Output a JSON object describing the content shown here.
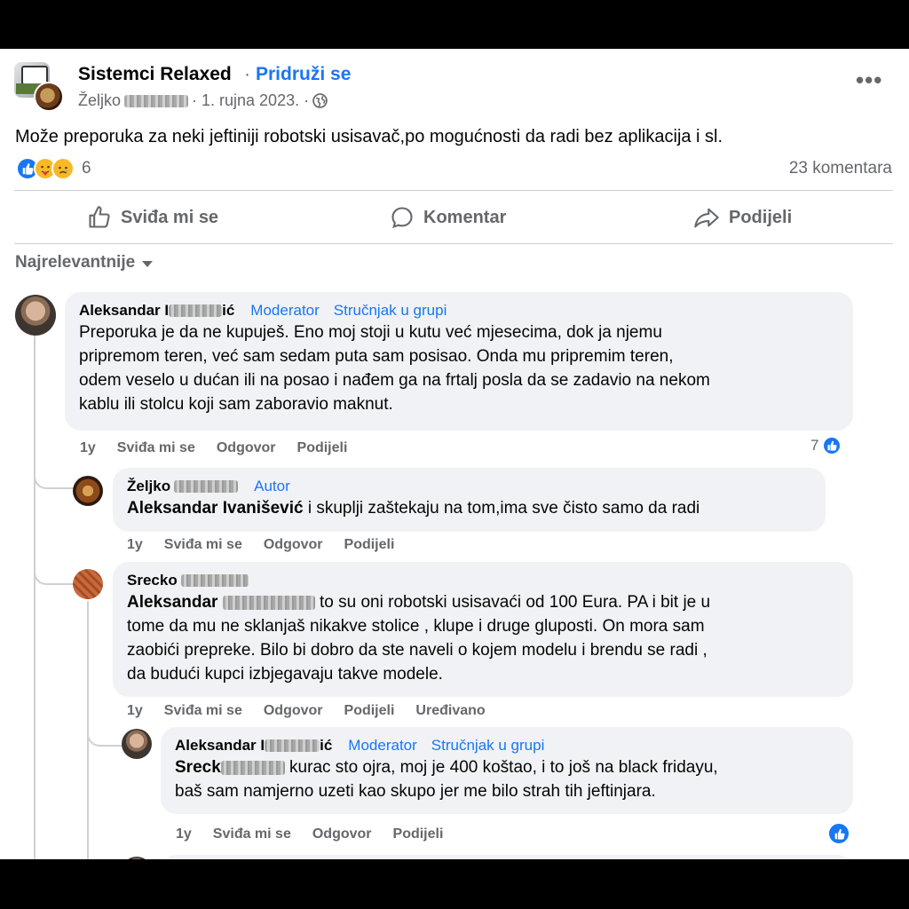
{
  "header": {
    "group_name": "Sistemci Relaxed",
    "separator": "·",
    "join_label": "Pridruži se",
    "author_first": "Željko",
    "date": "· 1. rujna 2023. ·"
  },
  "post": {
    "text": "Može preporuka za neki jeftiniji robotski usisavač,po mogućnosti da radi bez aplikacija i sl.",
    "reaction_count": "6",
    "comment_count": "23 komentara"
  },
  "actions": {
    "like": "Sviđa mi se",
    "comment": "Komentar",
    "share": "Podijeli"
  },
  "sort_label": "Najrelevantnije",
  "comments": [
    {
      "name_prefix": "Aleksandar I",
      "name_suffix": "ić",
      "badge1": "Moderator",
      "badge2": "Stručnjak u grupi",
      "lines": [
        "Preporuka je da ne kupuješ. Eno moj stoji u kutu već mjesecima, dok ja njemu",
        "pripremom teren, već sam sedam puta sam posisao. Onda mu pripremim teren,",
        "odem veselo u dućan ili na posao i nađem ga na frtalj posla da se zadavio na nekom",
        "kablu ili stolcu koji sam zaboravio maknut."
      ],
      "time": "1y",
      "like": "Sviđa mi se",
      "reply": "Odgovor",
      "share": "Podijeli",
      "likes": "7"
    },
    {
      "name_prefix": "Željko",
      "badge1": "Autor",
      "mention": "Aleksandar Ivanišević",
      "text": " i skuplji zaštekaju na tom,ima sve čisto samo da radi",
      "time": "1y",
      "like": "Sviđa mi se",
      "reply": "Odgovor",
      "share": "Podijeli"
    },
    {
      "name_prefix": "Srecko",
      "mention": "Aleksandar",
      "line1_rest": "to su oni robotski usisavaći od 100 Eura. PA i bit je u",
      "lines": [
        "tome da mu ne sklanjaš nikakve stolice , klupe i druge gluposti. On mora sam",
        "zaobići prepreke. Bilo bi dobro da ste naveli o kojem modelu i brendu se radi ,",
        "da budući kupci izbjegavaju takve modele."
      ],
      "time": "1y",
      "like": "Sviđa mi se",
      "reply": "Odgovor",
      "share": "Podijeli",
      "edited": "Uređivano"
    },
    {
      "name_prefix": "Aleksandar I",
      "name_suffix": "ić",
      "badge1": "Moderator",
      "badge2": "Stručnjak u grupi",
      "mention": "Sreck",
      "line1_rest": " kurac sto ojra, moj je 400 koštao, i to još na black fridayu,",
      "lines": [
        "baš sam namjerno uzeti kao skupo jer me bilo strah tih jeftinjara."
      ],
      "time": "1y",
      "like": "Sviđa mi se",
      "reply": "Odgovor",
      "share": "Podijeli"
    }
  ],
  "colors": {
    "accent": "#1877f2",
    "secondary_text": "#65676b",
    "bubble": "#f0f2f5"
  }
}
